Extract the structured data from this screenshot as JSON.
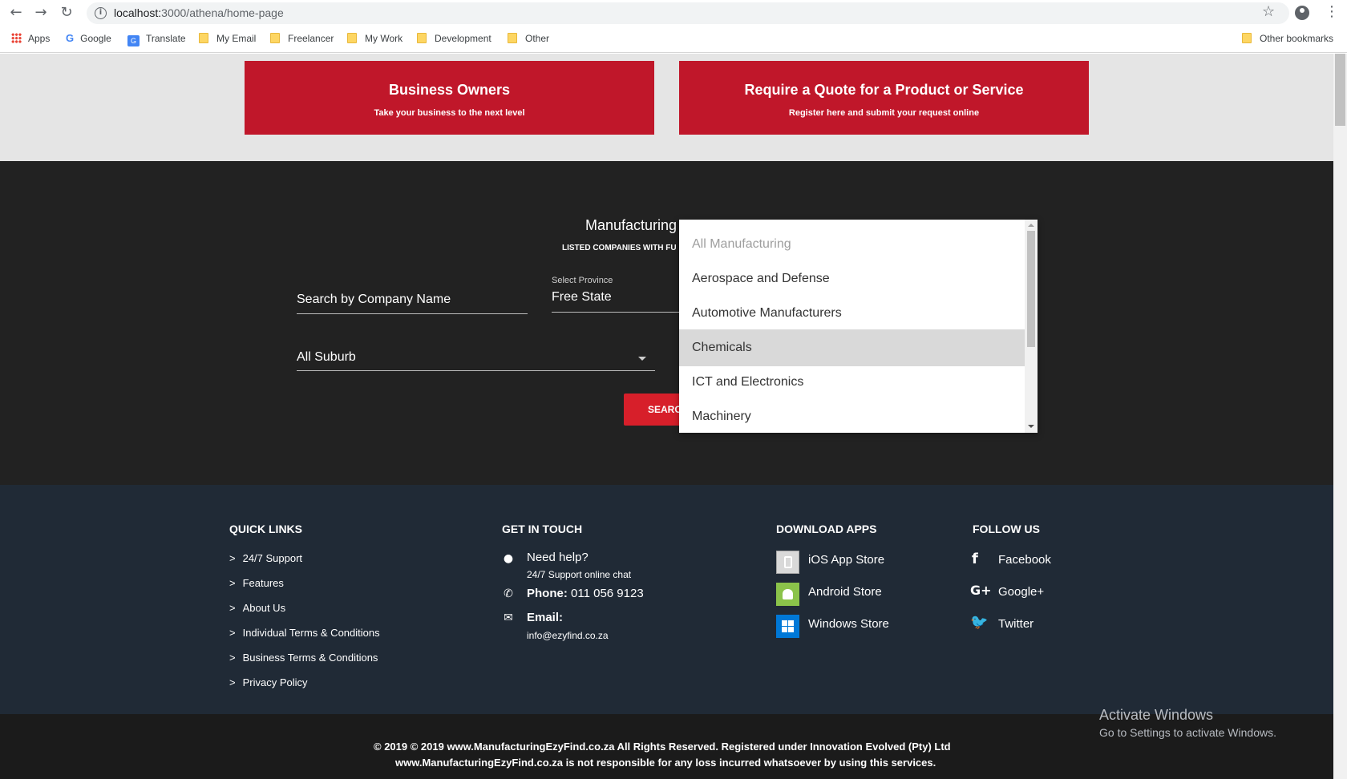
{
  "browser": {
    "url_host": "localhost:",
    "url_path": "3000/athena/home-page",
    "bookmarks": {
      "apps": "Apps",
      "google": "Google",
      "translate": "Translate",
      "my_email": "My Email",
      "freelancer": "Freelancer",
      "my_work": "My Work",
      "development": "Development",
      "other": "Other",
      "other_bookmarks": "Other bookmarks"
    }
  },
  "cta": {
    "business": {
      "title": "Business Owners",
      "subtitle": "Take your business to the next level"
    },
    "quote": {
      "title": "Require a Quote for a Product or Service",
      "subtitle": "Register here and submit your request online"
    }
  },
  "search": {
    "title_visible": "Manufacturing",
    "subtitle_visible": "LISTED COMPANIES WITH FU",
    "company_placeholder": "Search by Company Name",
    "province_label": "Select Province",
    "province_value": "Free State",
    "suburb_value": "All Suburb",
    "button_visible": "SEARC"
  },
  "dropdown": {
    "items": [
      "All Manufacturing",
      "Aerospace and Defense",
      "Automotive Manufacturers",
      "Chemicals",
      "ICT and Electronics",
      "Machinery"
    ],
    "selected": "Chemicals"
  },
  "footer": {
    "quick_links": {
      "heading": "QUICK LINKS",
      "items": [
        "24/7 Support",
        "Features",
        "About Us",
        "Individual Terms & Conditions",
        "Business Terms & Conditions",
        "Privacy Policy"
      ]
    },
    "get_in_touch": {
      "heading": "GET IN TOUCH",
      "help_title": "Need help?",
      "help_sub": "24/7 Support online chat",
      "phone_label": "Phone:",
      "phone_value": "011 056 9123",
      "email_label": "Email:",
      "email_value": "info@ezyfind.co.za"
    },
    "download_apps": {
      "heading": "DOWNLOAD APPS",
      "ios": "iOS App Store",
      "android": "Android Store",
      "windows": "Windows Store"
    },
    "follow_us": {
      "heading": "FOLLOW US",
      "facebook": "Facebook",
      "google": "Google+",
      "twitter": "Twitter"
    }
  },
  "copyright": {
    "line1": "© 2019 © 2019 www.ManufacturingEzyFind.co.za All Rights Reserved. Registered under Innovation Evolved (Pty) Ltd",
    "line2": "www.ManufacturingEzyFind.co.za is not responsible for any loss incurred whatsoever by using this services."
  },
  "windows_watermark": {
    "title": "Activate Windows",
    "subtitle": "Go to Settings to activate Windows."
  },
  "colors": {
    "cta_red": "#c0172a",
    "search_bg": "#222222",
    "footer_bg": "#202a36",
    "android_green": "#8bc34a",
    "windows_blue": "#0078d7"
  }
}
